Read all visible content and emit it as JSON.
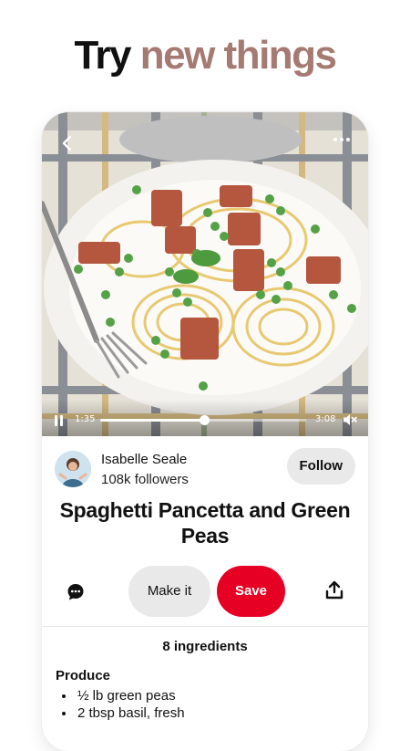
{
  "headline": {
    "part1": "Try",
    "part2": "new things"
  },
  "player": {
    "current_time": "1:35",
    "duration": "3:08",
    "progress": 0.505
  },
  "author": {
    "name": "Isabelle Seale",
    "followers": "108k followers"
  },
  "follow_label": "Follow",
  "pin_title": "Spaghetti Pancetta and Green Peas",
  "actions": {
    "make_it": "Make it",
    "save": "Save"
  },
  "ingredients": {
    "count_label": "8 ingredients",
    "section": "Produce",
    "items": [
      "½ lb green peas",
      "2 tbsp basil, fresh"
    ]
  },
  "colors": {
    "accent_red": "#e60023",
    "headline_accent": "#a57a72"
  }
}
